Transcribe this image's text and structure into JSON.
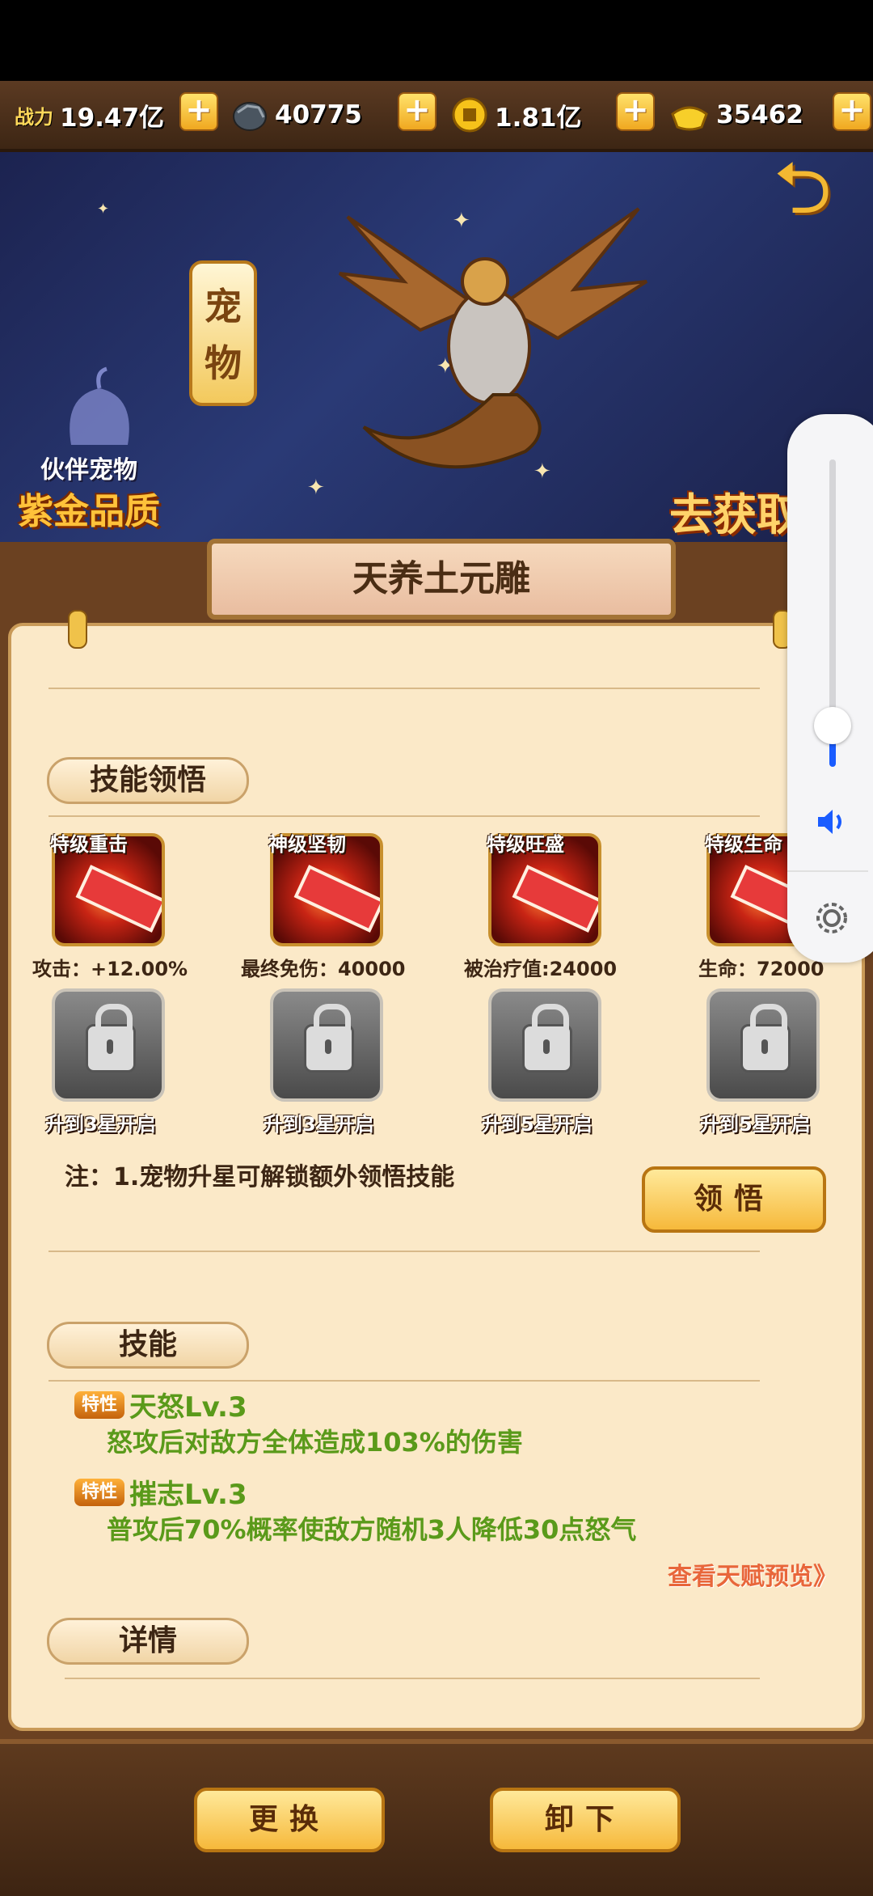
{
  "resources": {
    "power_label": "战力",
    "power_value": "19.47亿",
    "ore_value": "40775",
    "coin_value": "1.81亿",
    "gold_value": "35462",
    "plus": "+"
  },
  "banner": {
    "pet_tag": "宠物",
    "partner_label": "伙伴宠物",
    "quality_label": "紫金品质",
    "go_get": "去获取》"
  },
  "pet": {
    "name": "天养土元雕"
  },
  "skill_insight": {
    "header": "技能领悟",
    "skills": [
      {
        "name": "特级重击",
        "stat": "攻击：+12.00%"
      },
      {
        "name": "神级坚韧",
        "stat": "最终免伤：40000"
      },
      {
        "name": "特级旺盛",
        "stat": "被治疗值:24000"
      },
      {
        "name": "特级生命",
        "stat": "生命：72000"
      }
    ],
    "locks": [
      "升到3星开启",
      "升到3星开启",
      "升到5星开启",
      "升到5星开启"
    ],
    "note": "注：1.宠物升星可解锁额外领悟技能",
    "insight_button": "领悟"
  },
  "skills": {
    "header": "技能",
    "trait_badge": "特性",
    "traits": [
      {
        "name": "天怒Lv.3",
        "desc": "怒攻后对敌方全体造成103%的伤害"
      },
      {
        "name": "摧志Lv.3",
        "desc": "普攻后70%概率使敌方随机3人降低30点怒气"
      }
    ],
    "talent_preview": "查看天赋预览》"
  },
  "details": {
    "header": "详情"
  },
  "footer": {
    "replace_button": "更换",
    "unequip_button": "卸下"
  },
  "colors": {
    "accent_gold": "#f6b93b",
    "trait_green": "#5a9a1a",
    "volume_blue": "#1a5cff"
  }
}
